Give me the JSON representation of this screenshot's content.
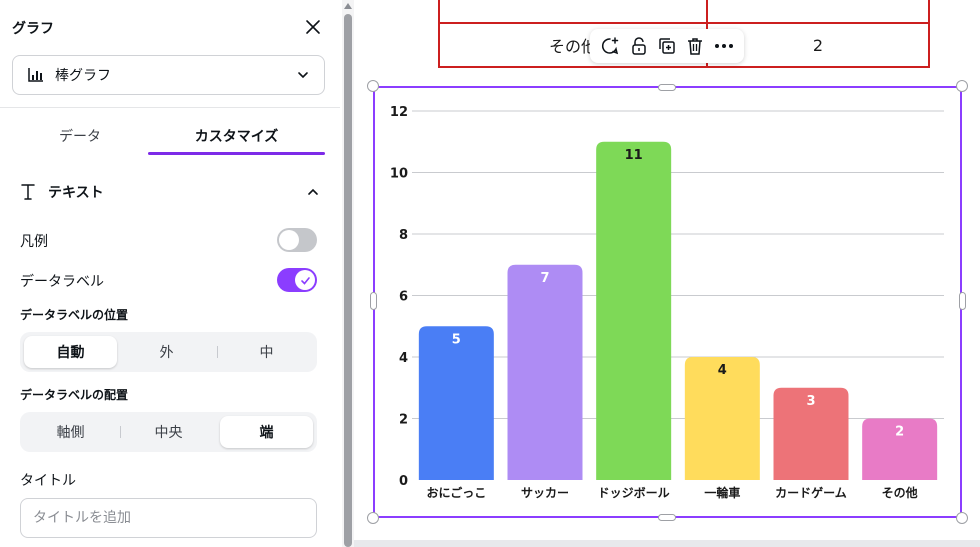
{
  "panel": {
    "title": "グラフ",
    "chart_type_label": "棒グラフ",
    "tabs": [
      {
        "label": "データ",
        "active": false
      },
      {
        "label": "カスタマイズ",
        "active": true
      }
    ],
    "section_title": "テキスト",
    "legend_label": "凡例",
    "legend_on": false,
    "data_label_label": "データラベル",
    "data_label_on": true,
    "position_title": "データラベルの位置",
    "position_options": [
      "自動",
      "外",
      "中"
    ],
    "position_selected": "自動",
    "alignment_title": "データラベルの配置",
    "alignment_options": [
      "軸側",
      "中央",
      "端"
    ],
    "alignment_selected": "端",
    "title_label": "タイトル",
    "title_placeholder": "タイトルを追加",
    "accent_color": "#8b3dff"
  },
  "canvas": {
    "table_rows": [
      {
        "label": "",
        "value": ""
      },
      {
        "label": "その他",
        "value": "2"
      }
    ],
    "toolbar_icons": [
      "comment-add-icon",
      "unlock-icon",
      "duplicate-icon",
      "trash-icon",
      "more-icon"
    ],
    "table_border_color": "#cc1f1f",
    "selection_color": "#8b3dff"
  },
  "chart_data": {
    "type": "bar",
    "categories": [
      "おにごっこ",
      "サッカー",
      "ドッジボール",
      "一輪車",
      "カードゲーム",
      "その他"
    ],
    "values": [
      5,
      7,
      11,
      4,
      3,
      2
    ],
    "colors": [
      "#4a7ef5",
      "#ae8cf4",
      "#7ed957",
      "#ffdc5c",
      "#ed7378",
      "#e87bc6"
    ],
    "label_colors": [
      "#ffffff",
      "#ffffff",
      "#1a1a1a",
      "#1a1a1a",
      "#ffffff",
      "#ffffff"
    ],
    "yticks": [
      "0",
      "2",
      "4",
      "6",
      "8",
      "10",
      "12"
    ],
    "ylim": [
      0,
      12
    ],
    "title": "",
    "legend": false,
    "grid": true
  }
}
